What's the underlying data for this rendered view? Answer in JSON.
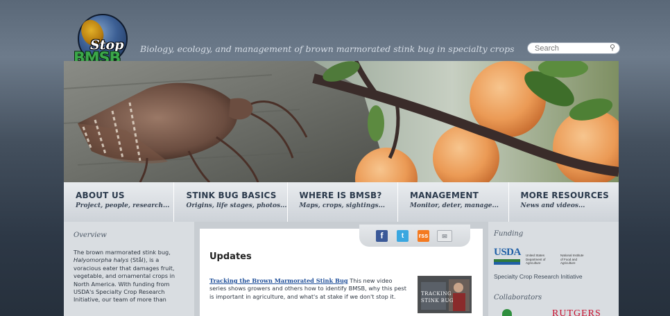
{
  "header": {
    "logo_top": "Stop",
    "logo_bottom": "BMSB",
    "tagline": "Biology, ecology, and management of brown marmorated stink bug in specialty crops",
    "search_placeholder": "Search",
    "search_icon": "magnifier-icon"
  },
  "nav": [
    {
      "title": "ABOUT US",
      "subtitle": "Project, people, research..."
    },
    {
      "title": "STINK BUG BASICS",
      "subtitle": "Origins, life stages, photos..."
    },
    {
      "title": "WHERE IS BMSB?",
      "subtitle": "Maps, crops, sightings..."
    },
    {
      "title": "MANAGEMENT",
      "subtitle": "Monitor, deter, manage..."
    },
    {
      "title": "MORE RESOURCES",
      "subtitle": "News and videos..."
    }
  ],
  "overview": {
    "heading": "Overview",
    "text_before": "The brown marmorated stink bug, ",
    "species": "Halyomorpha halys",
    "text_after": " (Stål), is a voracious eater that damages fruit, vegetable, and ornamental crops in North America. With funding from USDA's Specialty Crop Research Initiative, our team of more than"
  },
  "social": {
    "facebook": "f",
    "twitter": "t",
    "rss": "rss",
    "email": "✉"
  },
  "updates": {
    "heading": "Updates",
    "link_text": "Tracking the Brown Marmorated Stink Bug",
    "body": " This new video series shows growers and others how to identify BMSB, why this pest is important in agriculture, and what's at stake if we don't stop it.",
    "thumb_caption_1": "TRACKING",
    "thumb_caption_2": "STINK BUG"
  },
  "funding": {
    "heading": "Funding",
    "usda": "USDA",
    "usda_line1": "United States",
    "usda_line2": "Department of",
    "usda_line3": "Agriculture",
    "nifa_line1": "National Institute",
    "nifa_line2": "of Food and",
    "nifa_line3": "Agriculture",
    "program": "Specialty Crop Research Initiative",
    "collab_heading": "Collaborators",
    "rutgers": "RUTGERS"
  }
}
